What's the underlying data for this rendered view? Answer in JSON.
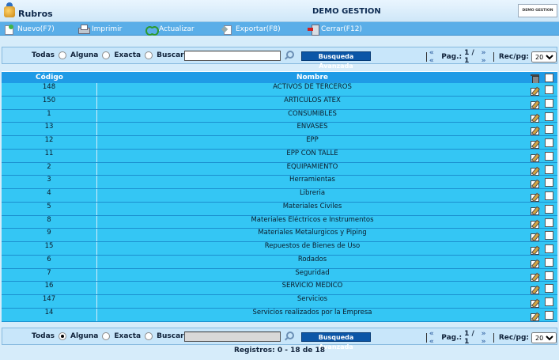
{
  "window": {
    "title": "Rubros",
    "company": "DEMO GESTION",
    "logo_text": "DEMO GESTION"
  },
  "toolbar": {
    "new": "Nuevo(F7)",
    "print": "Imprimir",
    "refresh": "Actualizar",
    "export": "Exportar(F8)",
    "close": "Cerrar(F12)"
  },
  "search_top": {
    "opt_all": "Todas",
    "opt_some": "Alguna",
    "opt_exact": "Exacta",
    "search_label": "Buscar",
    "value": "",
    "advanced": "Busqueda Avanzada",
    "pager_prev": "« «",
    "pager_label": "Pag.:",
    "pager_value": "1 / 1",
    "pager_next": "» »",
    "rec_label": "Rec/pg:",
    "rec_value": "20"
  },
  "search_bottom": {
    "opt_all": "Todas",
    "opt_some": "Alguna",
    "opt_exact": "Exacta",
    "search_label": "Buscar",
    "value": "",
    "advanced": "Busqueda Avanzada",
    "pager_prev": "« «",
    "pager_label": "Pag.:",
    "pager_value": "1 / 1",
    "pager_next": "» »",
    "rec_label": "Rec/pg:",
    "rec_value": "20"
  },
  "table": {
    "headers": {
      "code": "Código",
      "name": "Nombre"
    },
    "rows": [
      {
        "code": "148",
        "name": "ACTIVOS DE TERCEROS"
      },
      {
        "code": "150",
        "name": "ARTICULOS ATEX"
      },
      {
        "code": "1",
        "name": "CONSUMIBLES"
      },
      {
        "code": "13",
        "name": "ENVASES"
      },
      {
        "code": "12",
        "name": "EPP"
      },
      {
        "code": "11",
        "name": "EPP CON TALLE"
      },
      {
        "code": "2",
        "name": "EQUIPAMIENTO"
      },
      {
        "code": "3",
        "name": "Herramientas"
      },
      {
        "code": "4",
        "name": "Libreria"
      },
      {
        "code": "5",
        "name": "Materiales Civiles"
      },
      {
        "code": "8",
        "name": "Materiales Eléctricos e Instrumentos"
      },
      {
        "code": "9",
        "name": "Materiales Metalurgicos y Piping"
      },
      {
        "code": "15",
        "name": "Repuestos de Bienes de Uso"
      },
      {
        "code": "6",
        "name": "Rodados"
      },
      {
        "code": "7",
        "name": "Seguridad"
      },
      {
        "code": "16",
        "name": "SERVICIO MEDICO"
      },
      {
        "code": "147",
        "name": "Servicios"
      },
      {
        "code": "14",
        "name": "Servicios realizados por la Empresa"
      }
    ]
  },
  "footer": {
    "records": "Registros: 0 - 18 de 18"
  }
}
